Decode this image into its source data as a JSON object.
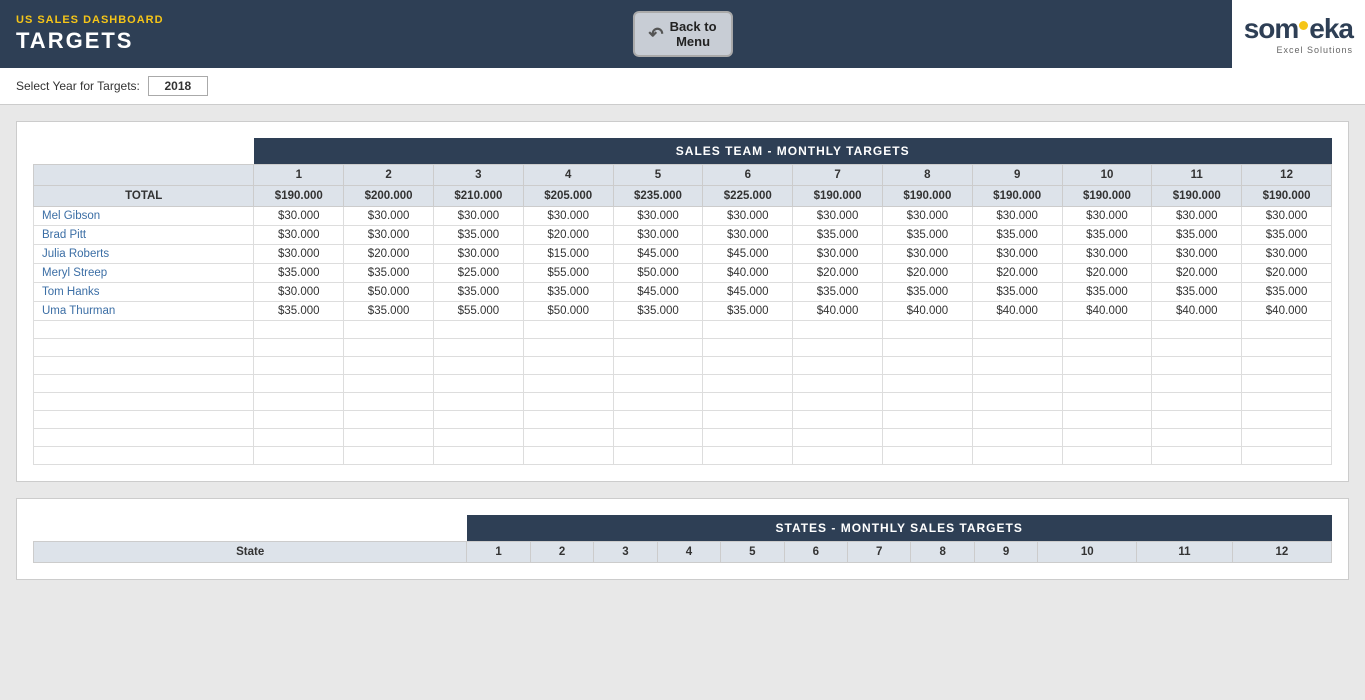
{
  "header": {
    "subtitle": "US SALES DASHBOARD",
    "title": "TARGETS",
    "back_button": "Back to\nMenu",
    "logo_main": "someka",
    "logo_sub": "Excel Solutions"
  },
  "year_selector": {
    "label": "Select Year for Targets:",
    "value": "2018"
  },
  "sales_team_table": {
    "section_header": "SALES TEAM - MONTHLY TARGETS",
    "name_col_header": "",
    "columns": [
      "1",
      "2",
      "3",
      "4",
      "5",
      "6",
      "7",
      "8",
      "9",
      "10",
      "11",
      "12"
    ],
    "total_row": {
      "label": "TOTAL",
      "values": [
        "$190.000",
        "$200.000",
        "$210.000",
        "$205.000",
        "$235.000",
        "$225.000",
        "$190.000",
        "$190.000",
        "$190.000",
        "$190.000",
        "$190.000",
        "$190.000"
      ]
    },
    "rows": [
      {
        "name": "Mel Gibson",
        "values": [
          "$30.000",
          "$30.000",
          "$30.000",
          "$30.000",
          "$30.000",
          "$30.000",
          "$30.000",
          "$30.000",
          "$30.000",
          "$30.000",
          "$30.000",
          "$30.000"
        ]
      },
      {
        "name": "Brad Pitt",
        "values": [
          "$30.000",
          "$30.000",
          "$35.000",
          "$20.000",
          "$30.000",
          "$30.000",
          "$35.000",
          "$35.000",
          "$35.000",
          "$35.000",
          "$35.000",
          "$35.000"
        ]
      },
      {
        "name": "Julia Roberts",
        "values": [
          "$30.000",
          "$20.000",
          "$30.000",
          "$15.000",
          "$45.000",
          "$45.000",
          "$30.000",
          "$30.000",
          "$30.000",
          "$30.000",
          "$30.000",
          "$30.000"
        ]
      },
      {
        "name": "Meryl Streep",
        "values": [
          "$35.000",
          "$35.000",
          "$25.000",
          "$55.000",
          "$50.000",
          "$40.000",
          "$20.000",
          "$20.000",
          "$20.000",
          "$20.000",
          "$20.000",
          "$20.000"
        ]
      },
      {
        "name": "Tom Hanks",
        "values": [
          "$30.000",
          "$50.000",
          "$35.000",
          "$35.000",
          "$45.000",
          "$45.000",
          "$35.000",
          "$35.000",
          "$35.000",
          "$35.000",
          "$35.000",
          "$35.000"
        ]
      },
      {
        "name": "Uma Thurman",
        "values": [
          "$35.000",
          "$35.000",
          "$55.000",
          "$50.000",
          "$35.000",
          "$35.000",
          "$40.000",
          "$40.000",
          "$40.000",
          "$40.000",
          "$40.000",
          "$40.000"
        ]
      }
    ],
    "empty_rows": 8
  },
  "states_table": {
    "section_header": "STATES - MONTHLY SALES TARGETS",
    "state_col_header": "State",
    "columns": [
      "1",
      "2",
      "3",
      "4",
      "5",
      "6",
      "7",
      "8",
      "9",
      "10",
      "11",
      "12"
    ]
  }
}
